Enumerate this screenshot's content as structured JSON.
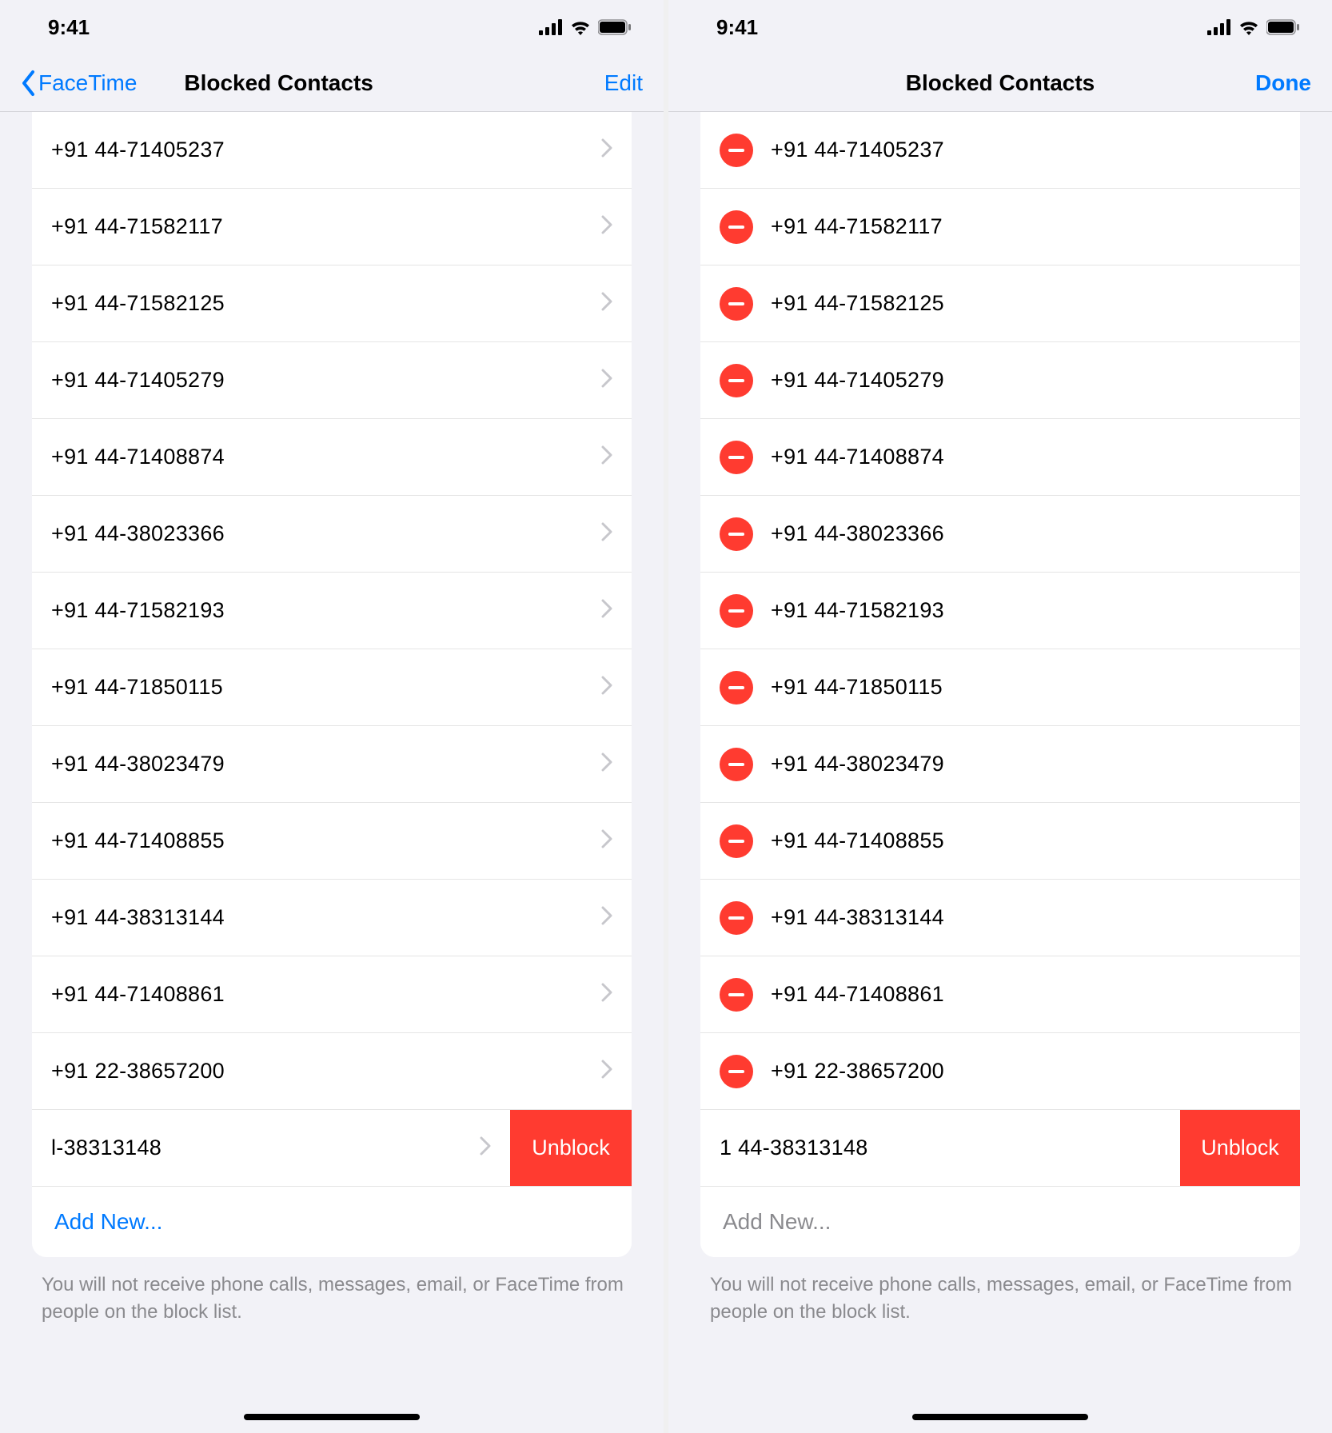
{
  "status": {
    "time": "9:41"
  },
  "left": {
    "nav": {
      "back_label": "FaceTime",
      "title": "Blocked Contacts",
      "right_label": "Edit"
    },
    "contacts": [
      "+91 44-71405237",
      "+91 44-71582117",
      "+91 44-71582125",
      "+91 44-71405279",
      "+91 44-71408874",
      "+91 44-38023366",
      "+91 44-71582193",
      "+91 44-71850115",
      "+91 44-38023479",
      "+91 44-71408855",
      "+91 44-38313144",
      "+91 44-71408861",
      "+91 22-38657200"
    ],
    "swiped": {
      "number_truncated": "l-38313148",
      "unblock_label": "Unblock"
    },
    "add_new_label": "Add New...",
    "footer": "You will not receive phone calls, messages, email, or FaceTime from people on the block list."
  },
  "right": {
    "nav": {
      "title": "Blocked Contacts",
      "right_label": "Done"
    },
    "contacts": [
      "+91 44-71405237",
      "+91 44-71582117",
      "+91 44-71582125",
      "+91 44-71405279",
      "+91 44-71408874",
      "+91 44-38023366",
      "+91 44-71582193",
      "+91 44-71850115",
      "+91 44-38023479",
      "+91 44-71408855",
      "+91 44-38313144",
      "+91 44-71408861",
      "+91 22-38657200"
    ],
    "slid": {
      "number": "1 44-38313148",
      "unblock_label": "Unblock"
    },
    "add_new_label": "Add New...",
    "footer": "You will not receive phone calls, messages, email, or FaceTime from people on the block list."
  }
}
